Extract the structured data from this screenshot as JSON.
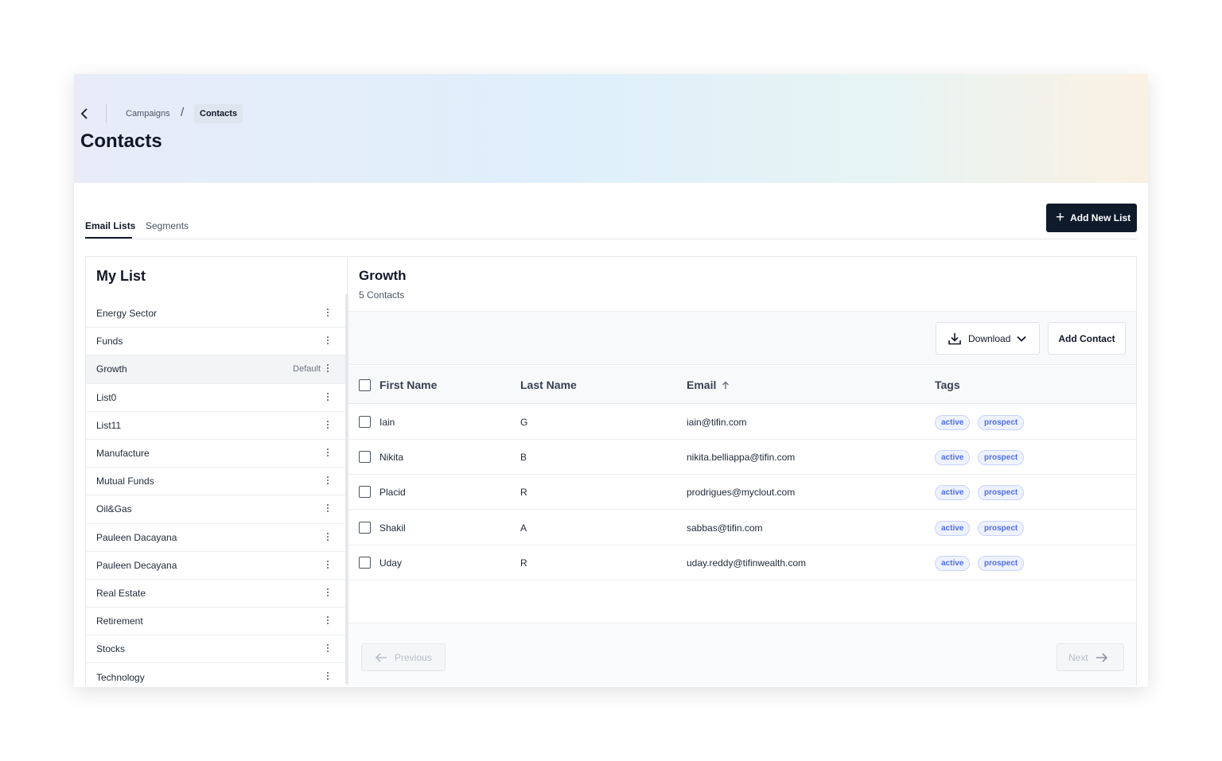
{
  "breadcrumb": {
    "parent": "Campaigns",
    "separator": "/",
    "current": "Contacts"
  },
  "page_title": "Contacts",
  "tabs": [
    {
      "label": "Email Lists",
      "active": true
    },
    {
      "label": "Segments",
      "active": false
    }
  ],
  "add_list_label": "Add New List",
  "left_panel": {
    "title": "My List",
    "default_label": "Default",
    "items": [
      {
        "label": "Energy Sector"
      },
      {
        "label": "Funds"
      },
      {
        "label": "Growth",
        "selected": true
      },
      {
        "label": "List0"
      },
      {
        "label": "List11"
      },
      {
        "label": "Manufacture"
      },
      {
        "label": "Mutual Funds"
      },
      {
        "label": "Oil&Gas"
      },
      {
        "label": "Pauleen Dacayana"
      },
      {
        "label": "Pauleen Decayana"
      },
      {
        "label": "Real Estate"
      },
      {
        "label": "Retirement"
      },
      {
        "label": "Stocks"
      },
      {
        "label": "Technology"
      }
    ]
  },
  "list_detail": {
    "title": "Growth",
    "subtitle": "5 Contacts",
    "download_label": "Download",
    "add_contact_label": "Add Contact",
    "columns": {
      "first": "First Name",
      "last": "Last Name",
      "email": "Email",
      "tags": "Tags"
    },
    "rows": [
      {
        "first": "Iain",
        "last": "G",
        "email": "iain@tifin.com",
        "tags": [
          "active",
          "prospect"
        ]
      },
      {
        "first": "Nikita",
        "last": "B",
        "email": "nikita.belliappa@tifin.com",
        "tags": [
          "active",
          "prospect"
        ]
      },
      {
        "first": "Placid",
        "last": "R",
        "email": "prodrigues@myclout.com",
        "tags": [
          "active",
          "prospect"
        ]
      },
      {
        "first": "Shakil",
        "last": "A",
        "email": "sabbas@tifin.com",
        "tags": [
          "active",
          "prospect"
        ]
      },
      {
        "first": "Uday",
        "last": "R",
        "email": "uday.reddy@tifinwealth.com",
        "tags": [
          "active",
          "prospect"
        ]
      }
    ],
    "pagination": {
      "previous": "Previous",
      "next": "Next"
    }
  },
  "colors": {
    "primary_button": "#0f1a2b",
    "tag_text": "#4f6fe8",
    "tag_bg": "#eef2ff"
  }
}
